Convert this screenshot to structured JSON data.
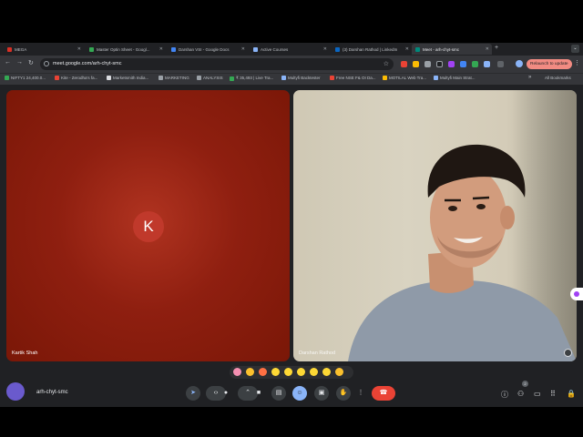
{
  "browser": {
    "tabs": [
      {
        "label": "MEGA",
        "color": "#d93025"
      },
      {
        "label": "Master Optin Sheet - Googl...",
        "color": "#34a853"
      },
      {
        "label": "Darshan VSI - Google Docs",
        "color": "#4285f4"
      },
      {
        "label": "Active Courses",
        "color": "#8ab4f8"
      },
      {
        "label": "(3) Darshan Rathod | LinkedIn",
        "color": "#0a66c2"
      },
      {
        "label": "Meet - arh-chyt-smc",
        "color": "#00897b"
      }
    ],
    "new_tab": "+",
    "tab_menu": "⌄",
    "address": "meet.google.com/arh-chyt-smc",
    "relaunch_label": "Relaunch to update",
    "bookmarks": [
      {
        "label": "NIFTY1 24,400.0...",
        "color": "#34a853"
      },
      {
        "label": "Kite - Zerodha's fa...",
        "color": "#ea4335"
      },
      {
        "label": "Marketsmith India...",
        "color": "#dadce0"
      },
      {
        "label": "MARKETING",
        "color": "#9aa0a6"
      },
      {
        "label": "ANALYSIS",
        "color": "#9aa0a6"
      },
      {
        "label": "₹ 35,493 | Live Tra...",
        "color": "#34a853"
      },
      {
        "label": "Multyfi Backtester",
        "color": "#8ab4f8"
      },
      {
        "label": "Free NSE F& OI Da...",
        "color": "#ea4335"
      },
      {
        "label": "MOTILAL Web Tra...",
        "color": "#fbbc04"
      },
      {
        "label": "Multyfi Main Strat...",
        "color": "#8ab4f8"
      }
    ],
    "bookmarks_more": "»",
    "all_bookmarks": "All Bookmarks"
  },
  "meet": {
    "participants": [
      {
        "name": "Kartik Shah",
        "initial": "K",
        "tile_color": "#8f1f10"
      },
      {
        "name": "Darshan Rathod"
      }
    ],
    "meeting_code": "arh-chyt-smc",
    "reactions": [
      "pink-heart",
      "thumbs-up",
      "party-popper",
      "clapping-hands",
      "laughing-face",
      "surprised-face",
      "crying-face",
      "thinking-face",
      "thumbs-down"
    ],
    "controls": {
      "end_call": "end-call"
    },
    "participant_count": "2"
  }
}
